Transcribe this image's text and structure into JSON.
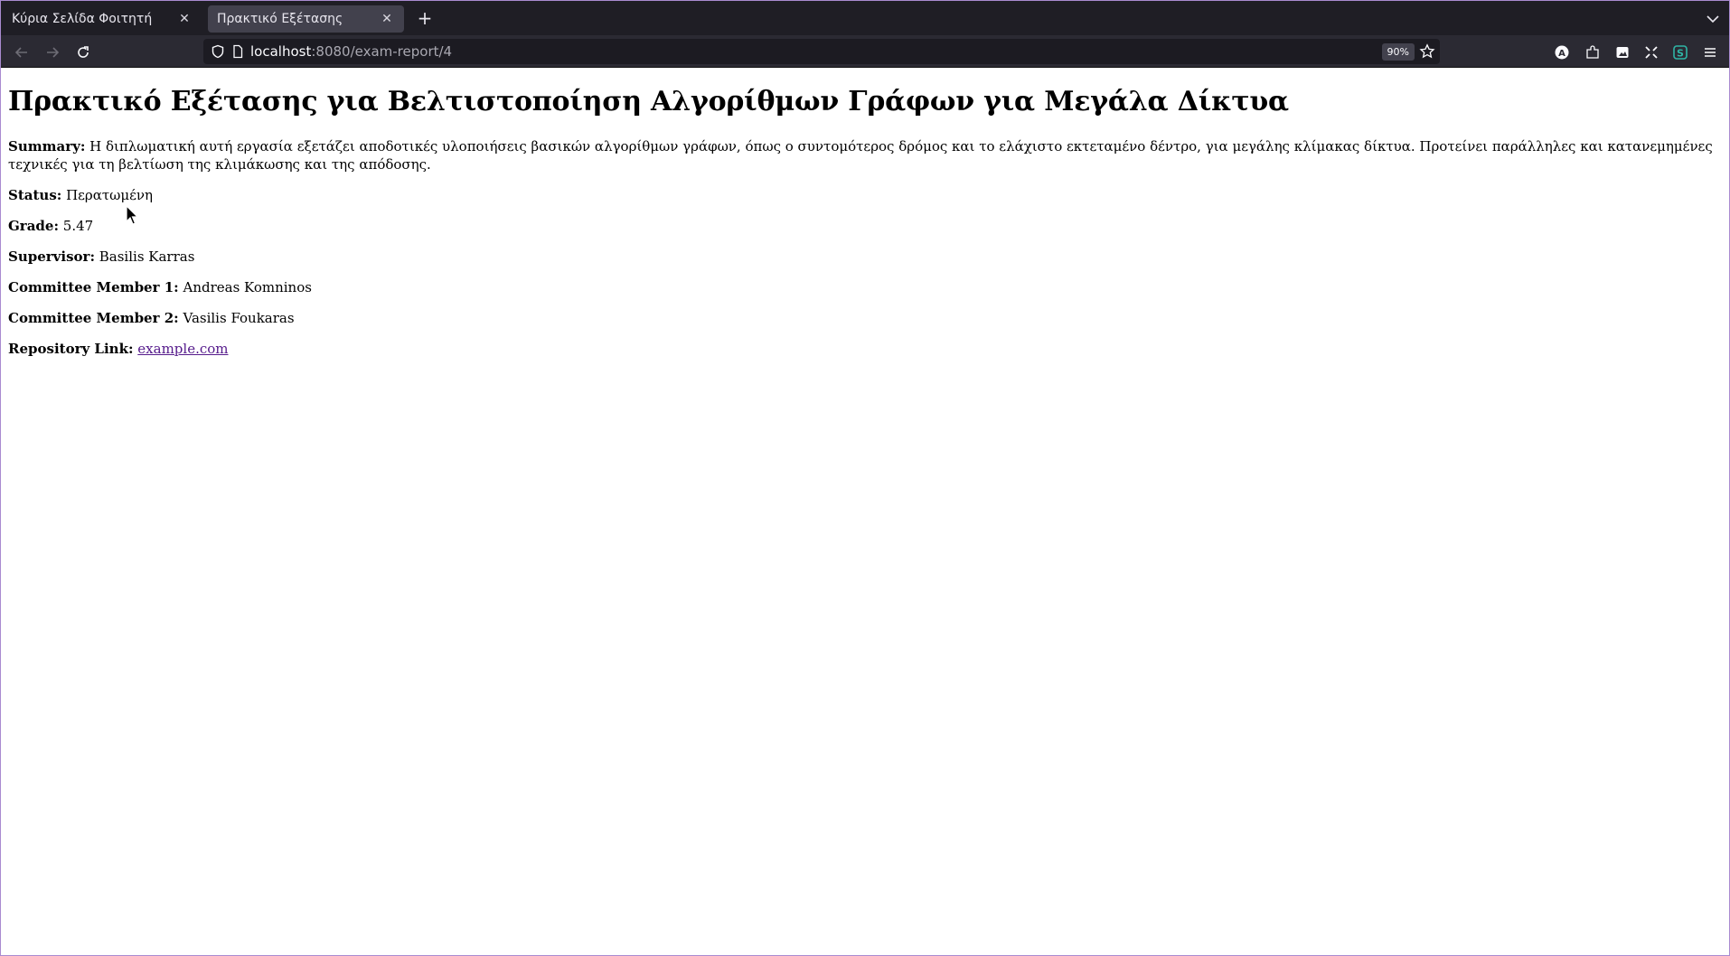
{
  "browser": {
    "tabs": [
      {
        "title": "Κύρια Σελίδα Φοιτητή"
      },
      {
        "title": "Πρακτικό Εξέτασης"
      }
    ],
    "url": {
      "host": "localhost",
      "path": ":8080/exam-report/4"
    },
    "zoom": "90%"
  },
  "report": {
    "title": "Πρακτικό Εξέτασης για Βελτιστοποίηση Αλγορίθμων Γράφων για Μεγάλα Δίκτυα",
    "summary_label": "Summary:",
    "summary": "Η διπλωματική αυτή εργασία εξετάζει αποδοτικές υλοποιήσεις βασικών αλγορίθμων γράφων, όπως ο συντομότερος δρόμος και το ελάχιστο εκτεταμένο δέντρο, για μεγάλης κλίμακας δίκτυα. Προτείνει παράλληλες και κατανεμημένες τεχνικές για τη βελτίωση της κλιμάκωσης και της απόδοσης.",
    "status_label": "Status:",
    "status": "Περατωμένη",
    "grade_label": "Grade:",
    "grade": "5.47",
    "supervisor_label": "Supervisor:",
    "supervisor": "Basilis Karras",
    "member1_label": "Committee Member 1:",
    "member1": "Andreas Komninos",
    "member2_label": "Committee Member 2:",
    "member2": "Vasilis Foukaras",
    "repo_label": "Repository Link:",
    "repo_link": "example.com"
  },
  "icons": {
    "back": "arrow-left-icon",
    "forward": "arrow-right-icon",
    "reload": "reload-icon",
    "shield": "shield-icon",
    "page": "page-icon",
    "star": "star-icon",
    "menu": "hamburger-icon"
  }
}
